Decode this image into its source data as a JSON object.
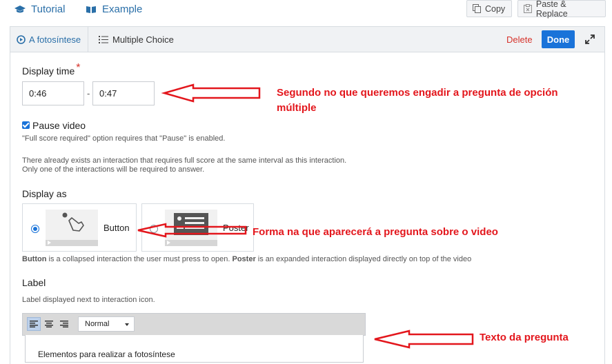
{
  "toplinks": {
    "tutorial": "Tutorial",
    "example": "Example"
  },
  "topbuttons": {
    "copy": "Copy",
    "paste": "Paste & Replace"
  },
  "header": {
    "crumb_parent": "A fotosíntese",
    "crumb_current": "Multiple Choice",
    "delete": "Delete",
    "done": "Done"
  },
  "display_time": {
    "label": "Display time",
    "required_mark": "*",
    "start": "0:46",
    "separator": "-",
    "end": "0:47"
  },
  "pause": {
    "label": "Pause video",
    "checked": true,
    "note": "\"Full score required\" option requires that \"Pause\" is enabled.",
    "warning_1": "There already exists an interaction that requires full score at the same interval as this interaction.",
    "warning_2": "Only one of the interactions will be required to answer."
  },
  "display_as": {
    "label": "Display as",
    "button_label": "Button",
    "poster_label": "Poster",
    "selected": "Button",
    "desc_button": "Button",
    "desc_mid": " is a collapsed interaction the user must press to open. ",
    "desc_poster": "Poster",
    "desc_end": " is an expanded interaction displayed directly on top of the video"
  },
  "label_field": {
    "label": "Label",
    "description": "Label displayed next to interaction icon.",
    "format": "Normal",
    "text": "Elementos para realizar a fotosíntese"
  },
  "annotations": {
    "time": "Segundo no que queremos engadir a pregunta de opción múltiple",
    "display": "Forma na que aparecerá a pregunta sobre o video",
    "text": "Texto da pregunta",
    "color": "#e3161c"
  },
  "colors": {
    "accent": "#1a73d9",
    "link": "#2a6fa8",
    "danger": "#d6322a"
  }
}
